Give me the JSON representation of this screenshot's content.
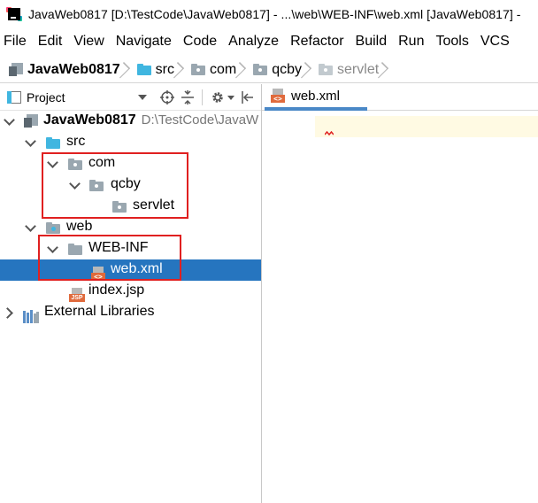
{
  "window": {
    "title": "JavaWeb0817 [D:\\TestCode\\JavaWeb0817] - ...\\web\\WEB-INF\\web.xml [JavaWeb0817] - "
  },
  "menu": [
    "File",
    "Edit",
    "View",
    "Navigate",
    "Code",
    "Analyze",
    "Refactor",
    "Build",
    "Run",
    "Tools",
    "VCS"
  ],
  "breadcrumb": {
    "project": "JavaWeb0817",
    "items": [
      "src",
      "com",
      "qcby",
      "servlet"
    ]
  },
  "panel": {
    "title": "Project"
  },
  "tree": {
    "project_name": "JavaWeb0817",
    "project_path": "D:\\TestCode\\JavaW",
    "src": "src",
    "com": "com",
    "qcby": "qcby",
    "servlet": "servlet",
    "web": "web",
    "web_inf": "WEB-INF",
    "web_xml": "web.xml",
    "index_jsp": "index.jsp",
    "external_libraries": "External Libraries"
  },
  "editor": {
    "tab_label": "web.xml"
  },
  "icons": {
    "xml_tag": "<>",
    "jsp_tag": "JSP"
  },
  "colors": {
    "selection": "#2675bf",
    "highlight_box": "#e02020",
    "current_line": "#fffae3"
  }
}
